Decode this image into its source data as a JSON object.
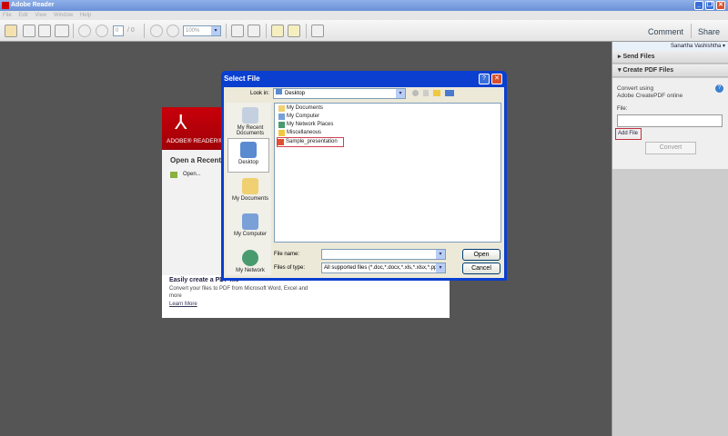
{
  "app": {
    "title": "Adobe Reader"
  },
  "menu": [
    "File",
    "Edit",
    "View",
    "Window",
    "Help"
  ],
  "toolbar": {
    "page_current": "0",
    "page_total": "/ 0",
    "zoom": "100%",
    "comment": "Comment",
    "share": "Share"
  },
  "right_panel": {
    "user": "Sanartha Vashishtha",
    "send_files": "Send Files",
    "create_pdf": "Create PDF Files",
    "convert_line1": "Convert using",
    "convert_line2": "Adobe CreatePDF online",
    "file_label": "File:",
    "add_file": "Add File",
    "convert": "Convert"
  },
  "welcome": {
    "brand": "ADOBE® READER®",
    "open_recent": "Open a Recent File",
    "open": "Open...",
    "easily_title": "Easily create a PDF file",
    "easily_text": "Convert your files to PDF from Microsoft Word, Excel and more",
    "learn_more": "Learn More"
  },
  "dialog": {
    "title": "Select File",
    "look_in_label": "Look in:",
    "look_in": "Desktop",
    "places": [
      "My Recent Documents",
      "Desktop",
      "My Documents",
      "My Computer",
      "My Network"
    ],
    "files": [
      "My Documents",
      "My Computer",
      "My Network Places",
      "Miscellaneous",
      "Sample_presentation"
    ],
    "file_name_label": "File name:",
    "file_name": "",
    "file_type_label": "Files of type:",
    "file_type": "All supported files (*.doc,*.docx,*.xls,*.xlsx,*.ppt",
    "open": "Open",
    "cancel": "Cancel"
  },
  "colors": {
    "accent": "#0a3fd0",
    "adobe_red": "#c8000a",
    "highlight": "#d04050"
  }
}
